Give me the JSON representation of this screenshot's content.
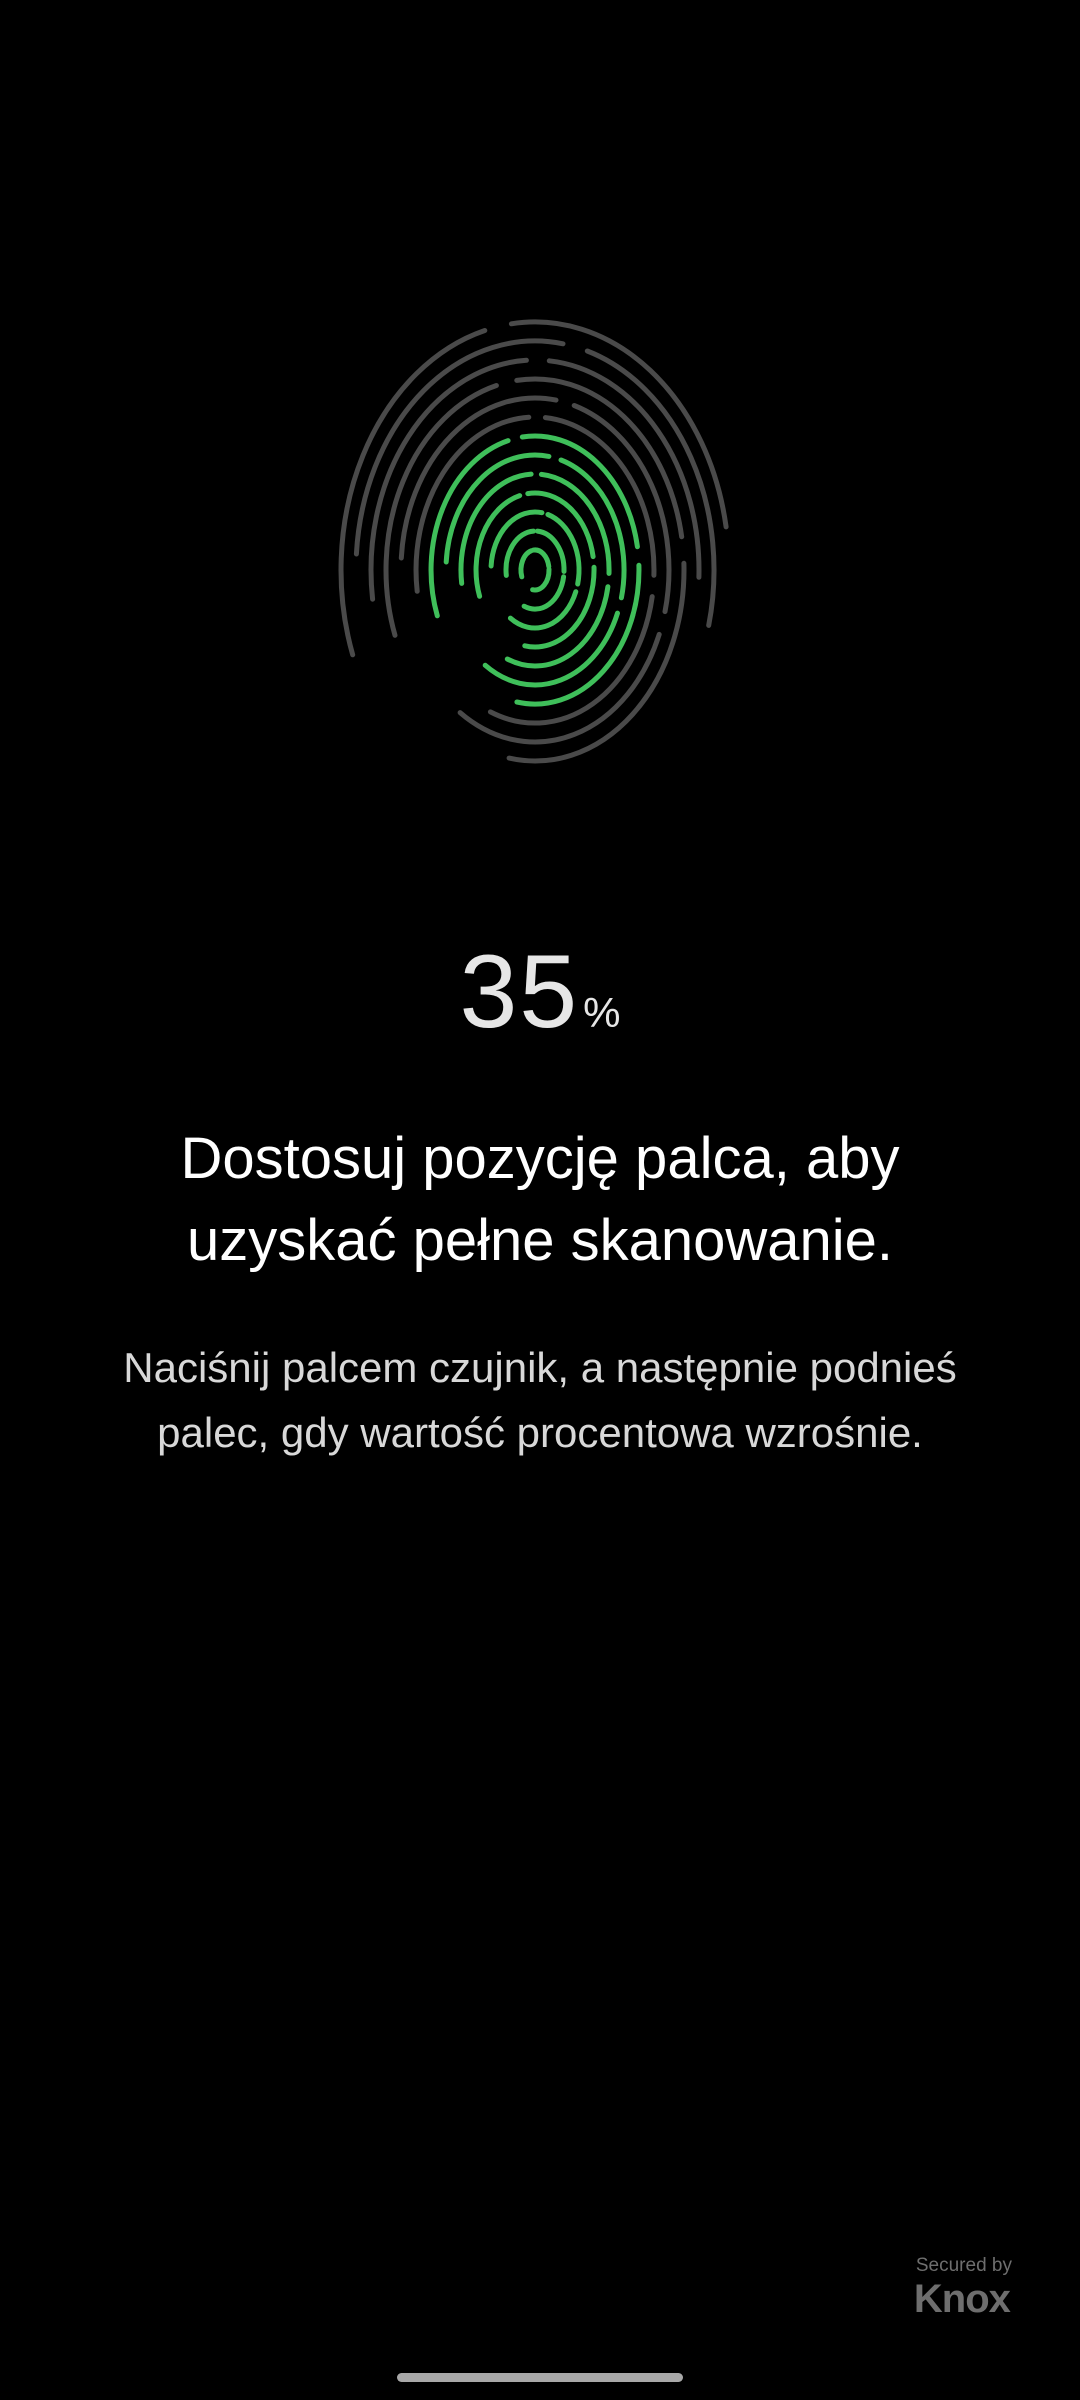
{
  "enrollment": {
    "progress_value": "35",
    "progress_unit": "%",
    "progress_fraction": 0.35,
    "title": "Dostosuj pozycję palca, aby uzyskać pełne skanowanie.",
    "instruction": "Naciśnij palcem czujnik, a następnie podnieś palec, gdy wartość procentowa wzrośnie."
  },
  "branding": {
    "secured_by": "Secured by",
    "brand": "Knox"
  },
  "icons": {
    "fingerprint": "fingerprint-icon"
  },
  "colors": {
    "background": "#000000",
    "scanned_ridge": "#3fbf5a",
    "unscanned_ridge": "#4a4a4a",
    "text_primary": "#ffffff",
    "text_secondary": "#d8d8d8"
  }
}
